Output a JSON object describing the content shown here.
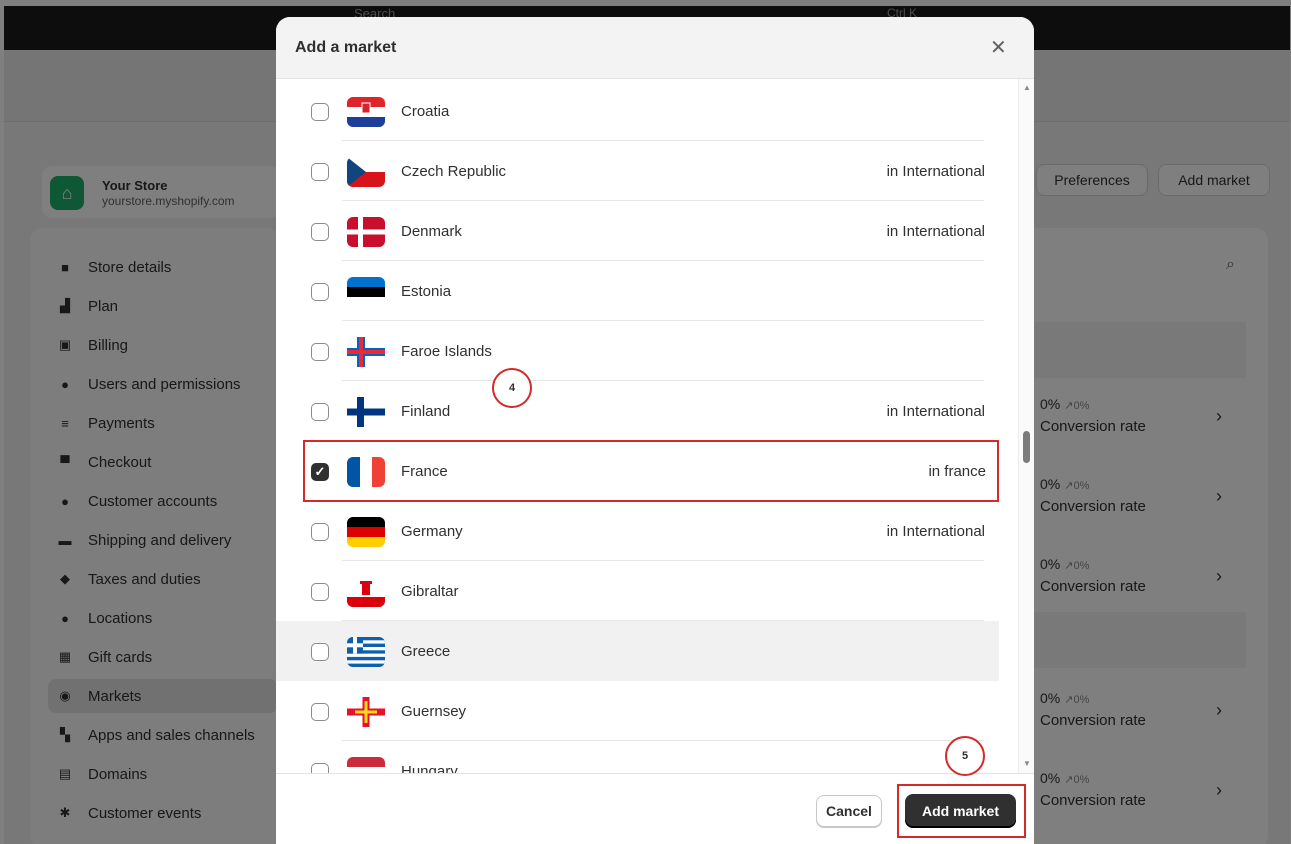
{
  "background": {
    "search_placeholder": "Search",
    "search_shortcut": "Ctrl K",
    "store": {
      "name": "Your Store",
      "url": "yourstore.myshopify.com"
    },
    "sidebar_items": [
      {
        "label": "Store details",
        "icon": "store-icon"
      },
      {
        "label": "Plan",
        "icon": "chart-icon"
      },
      {
        "label": "Billing",
        "icon": "receipt-icon"
      },
      {
        "label": "Users and permissions",
        "icon": "users-icon"
      },
      {
        "label": "Payments",
        "icon": "payments-icon"
      },
      {
        "label": "Checkout",
        "icon": "cart-icon"
      },
      {
        "label": "Customer accounts",
        "icon": "person-icon"
      },
      {
        "label": "Shipping and delivery",
        "icon": "truck-icon"
      },
      {
        "label": "Taxes and duties",
        "icon": "tax-icon"
      },
      {
        "label": "Locations",
        "icon": "location-icon"
      },
      {
        "label": "Gift cards",
        "icon": "gift-card-icon"
      },
      {
        "label": "Markets",
        "icon": "globe-icon"
      },
      {
        "label": "Apps and sales channels",
        "icon": "apps-icon"
      },
      {
        "label": "Domains",
        "icon": "domain-icon"
      },
      {
        "label": "Customer events",
        "icon": "cursor-icon"
      }
    ],
    "header_buttons": {
      "preferences": "Preferences",
      "add_market": "Add market"
    },
    "stats": [
      {
        "pct": "0%",
        "delta": "↗0%",
        "label": "Conversion rate"
      },
      {
        "pct": "0%",
        "delta": "↗0%",
        "label": "Conversion rate"
      },
      {
        "pct": "0%",
        "delta": "↗0%",
        "label": "Conversion rate"
      },
      {
        "pct": "0%",
        "delta": "↗0%",
        "label": "Conversion rate"
      },
      {
        "pct": "0%",
        "delta": "↗0%",
        "label": "Conversion rate"
      }
    ]
  },
  "modal": {
    "title": "Add a market",
    "countries": [
      {
        "name": "Croatia",
        "tag": "",
        "checked": false
      },
      {
        "name": "Czech Republic",
        "tag": "in International",
        "checked": false
      },
      {
        "name": "Denmark",
        "tag": "in International",
        "checked": false
      },
      {
        "name": "Estonia",
        "tag": "",
        "checked": false
      },
      {
        "name": "Faroe Islands",
        "tag": "",
        "checked": false
      },
      {
        "name": "Finland",
        "tag": "in International",
        "checked": false
      },
      {
        "name": "France",
        "tag": "in france",
        "checked": true
      },
      {
        "name": "Germany",
        "tag": "in International",
        "checked": false
      },
      {
        "name": "Gibraltar",
        "tag": "",
        "checked": false
      },
      {
        "name": "Greece",
        "tag": "",
        "checked": false
      },
      {
        "name": "Guernsey",
        "tag": "",
        "checked": false
      },
      {
        "name": "Hungary",
        "tag": "",
        "checked": false
      }
    ],
    "cancel_label": "Cancel",
    "add_label": "Add market"
  },
  "annotations": {
    "step4": "4",
    "step5": "5"
  },
  "colors": {
    "highlight": "#d42a2a",
    "primary_button": "#303030"
  }
}
